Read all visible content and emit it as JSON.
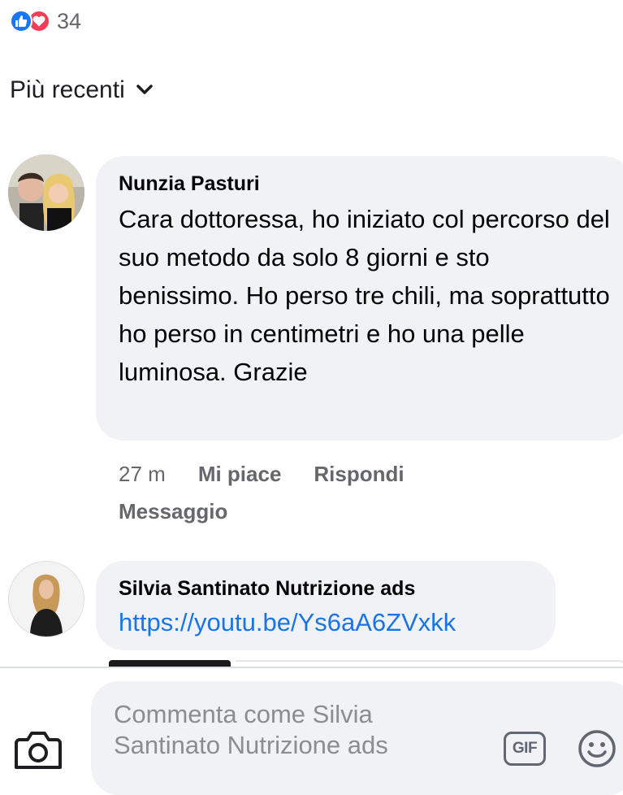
{
  "reactions": {
    "count": "34",
    "types": [
      "like-icon",
      "heart-icon"
    ],
    "like_color": "#1877f2",
    "love_color": "#f33e58"
  },
  "sort": {
    "label": "Più recenti"
  },
  "comments": [
    {
      "author": "Nunzia Pasturi",
      "text": "Cara dottoressa, ho iniziato col percorso del suo metodo da solo 8 giorni e sto benissimo. Ho perso tre chili, ma soprattutto ho perso in centimetri e ho una pelle luminosa. Grazie",
      "time": "27 m",
      "like_label": "Mi piace",
      "reply_label": "Rispondi",
      "message_label": "Messaggio"
    },
    {
      "author": "Silvia Santinato Nutrizione ads",
      "link": "https://youtu.be/Ys6aA6ZVxkk"
    }
  ],
  "composer": {
    "placeholder": "Commenta come Silvia Santinato Nutrizione ads",
    "gif_label": "GIF"
  },
  "colors": {
    "bubble": "#f0f2f5",
    "link": "#1b74e4",
    "meta": "#65676b"
  }
}
